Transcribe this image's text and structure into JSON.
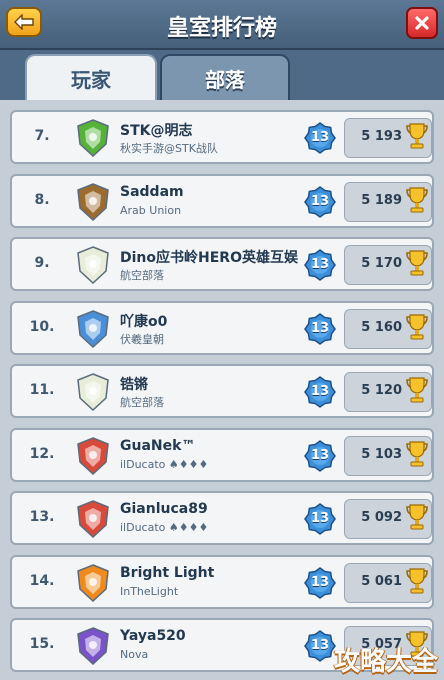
{
  "header": {
    "title": "皇室排行榜"
  },
  "tabs": [
    {
      "label": "玩家"
    },
    {
      "label": "部落"
    }
  ],
  "rows": [
    {
      "rank": "7.",
      "name": "STK@明志",
      "clan": "秋实手游@STK战队",
      "level": "13",
      "trophies": "5 193",
      "badge_color": "#55b33a"
    },
    {
      "rank": "8.",
      "name": "Saddam",
      "clan": "Arab Union",
      "level": "13",
      "trophies": "5 189",
      "badge_color": "#9b6b2f"
    },
    {
      "rank": "9.",
      "name": "Dino应书岭HERO英雄互娱",
      "clan": "航空部落",
      "level": "13",
      "trophies": "5 170",
      "badge_color": "#e7edd8"
    },
    {
      "rank": "10.",
      "name": "吖康o0",
      "clan": "伏羲皇朝",
      "level": "13",
      "trophies": "5 160",
      "badge_color": "#4a90d9"
    },
    {
      "rank": "11.",
      "name": "锆锵",
      "clan": "航空部落",
      "level": "13",
      "trophies": "5 120",
      "badge_color": "#e7edd8"
    },
    {
      "rank": "12.",
      "name": "GuaNek™",
      "clan": "ilDucato ♠♦♦♦",
      "level": "13",
      "trophies": "5 103",
      "badge_color": "#d84a3a"
    },
    {
      "rank": "13.",
      "name": "Gianluca89",
      "clan": "ilDucato ♠♦♦♦",
      "level": "13",
      "trophies": "5 092",
      "badge_color": "#d84a3a"
    },
    {
      "rank": "14.",
      "name": "Bright Light",
      "clan": "InTheLight",
      "level": "13",
      "trophies": "5 061",
      "badge_color": "#f08a1c"
    },
    {
      "rank": "15.",
      "name": "Yaya520",
      "clan": "Nova",
      "level": "13",
      "trophies": "5 057",
      "badge_color": "#7a52c9"
    }
  ],
  "watermark": "攻略大全"
}
